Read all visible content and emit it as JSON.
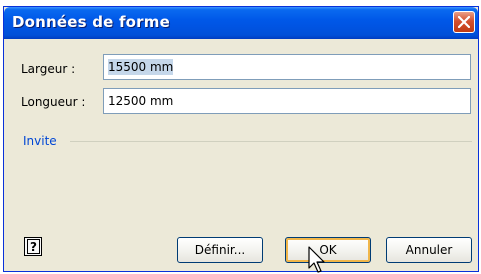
{
  "window": {
    "title": "Données de forme",
    "close_icon": "close-icon"
  },
  "fields": [
    {
      "label": "Largeur :",
      "value": "15500 mm",
      "selected": true
    },
    {
      "label": "Longueur :",
      "value": "12500 mm",
      "selected": false
    }
  ],
  "group": {
    "label": "Invite"
  },
  "buttons": {
    "help_icon": "help-icon",
    "define": "Définir...",
    "ok": "OK",
    "cancel": "Annuler"
  },
  "colors": {
    "titlebar": "#0054e3",
    "dialog_bg": "#ece9d8",
    "group_label": "#0046d5",
    "selection": "#c5d7ea",
    "default_button_glow": "#f0b64a"
  },
  "cursor_icon": "arrow-cursor-icon"
}
